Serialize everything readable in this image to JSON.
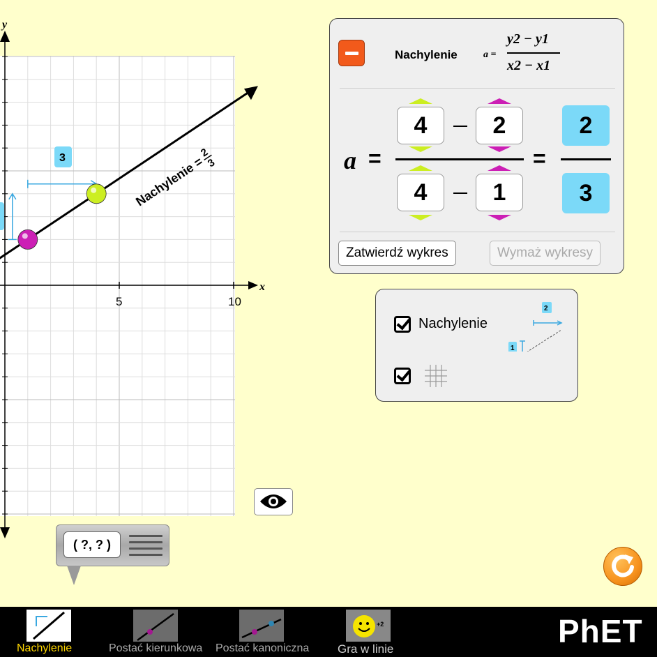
{
  "graph": {
    "x_axis_label": "x",
    "y_axis_label": "y",
    "x_ticks": [
      "5",
      "10"
    ],
    "slope_label_prefix": "Nachylenie =",
    "slope_label_numerator": "2",
    "slope_label_denominator": "3",
    "run_label": "3",
    "point1": {
      "x": 1,
      "y": 2,
      "color": "#cc1fb5"
    },
    "point2": {
      "x": 4,
      "y": 4,
      "color": "#ccee22"
    },
    "line_color": "#000000",
    "grid_on": true
  },
  "equation_panel": {
    "title": "Nachylenie",
    "formula_lhs": "a =",
    "formula_num": "y2 − y1",
    "formula_den": "x2 − x1",
    "a_label": "a",
    "equals": "=",
    "num_left": "4",
    "num_right": "2",
    "den_left": "4",
    "den_right": "1",
    "result_num": "2",
    "result_den": "3",
    "accent_color": "#7bd9f8",
    "confirm_button": "Zatwierdź wykres",
    "clear_button": "Wymaż wykresy"
  },
  "options_panel": {
    "slope_checkbox_label": "Nachylenie",
    "slope_checked": true,
    "grid_checked": true,
    "mini_run": "2",
    "mini_rise": "1"
  },
  "point_tool": {
    "readout": "( ?, ? )"
  },
  "navbar": {
    "tabs": [
      {
        "label": "Nachylenie",
        "active": true
      },
      {
        "label": "Postać kierunkowa",
        "active": false
      },
      {
        "label": "Postać kanoniczna",
        "active": false
      },
      {
        "label": "Gra w linie",
        "active": false
      }
    ],
    "game_icon_badge": "+2",
    "logo": "PhET",
    "active_color": "#ffd700"
  }
}
